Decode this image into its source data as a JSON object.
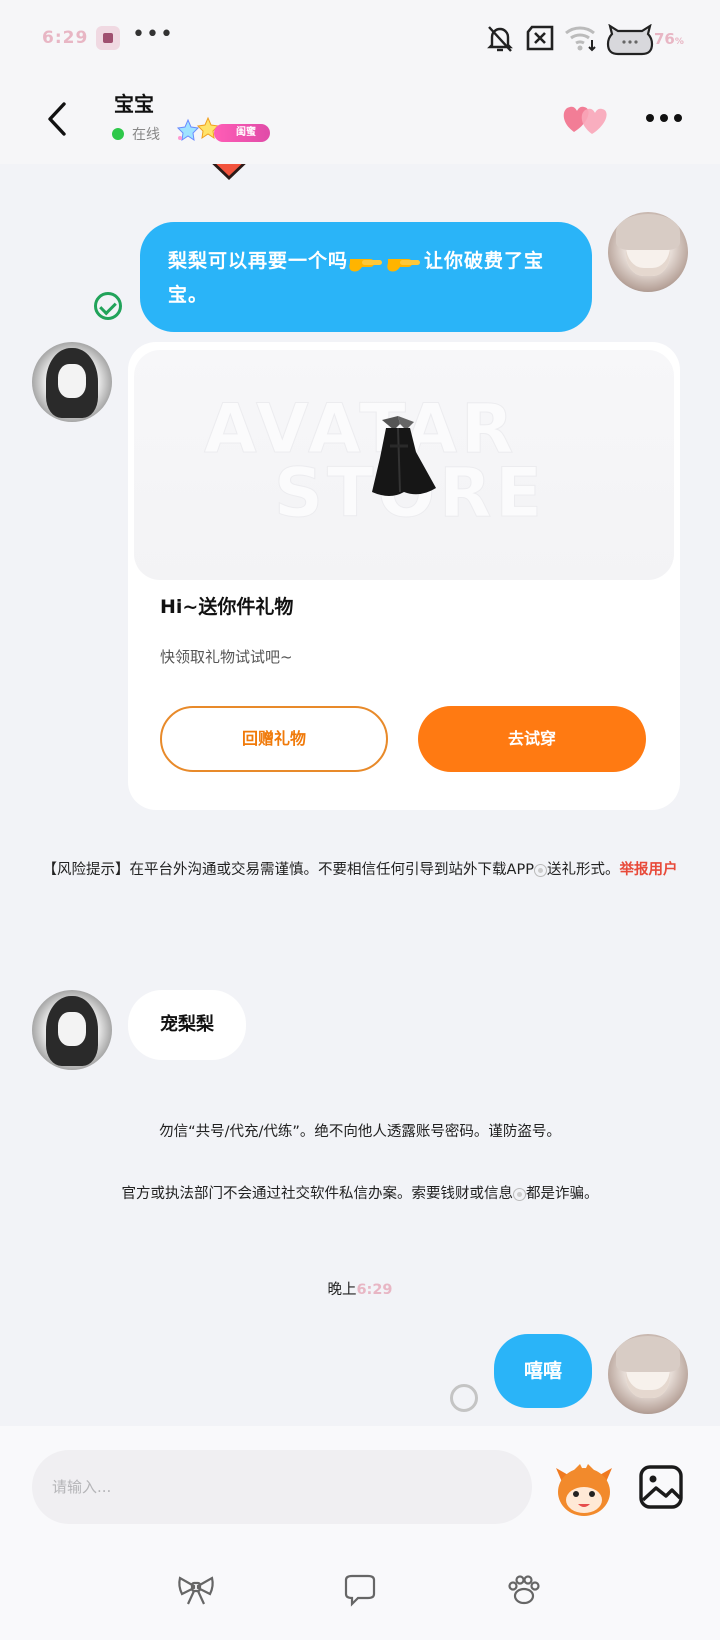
{
  "status_bar": {
    "time": "6:29",
    "dots": "•••",
    "battery": "76"
  },
  "header": {
    "name": "宝宝",
    "status": "在线",
    "badge": "闺蜜"
  },
  "messages": {
    "msg1_text": "梨梨可以再要一个吗👉👉让你破费了宝宝。",
    "msg1_part1": "梨梨可以再要一个吗",
    "msg1_part2": "让你破费了宝宝。",
    "gift_card": {
      "watermark_line1": "AVATAR",
      "watermark_line2": "STORE",
      "title": "Hi~送你件礼物",
      "subtitle": "快领取礼物试试吧~",
      "return_gift_label": "回赠礼物",
      "try_on_label": "去试穿"
    },
    "risk_notice_prefix": "【风险提示】在平台外沟通或交易需谨慎。不要相信任何引导到站外下载APP",
    "risk_notice_suffix": "送礼形式。",
    "report_link": "举报用户",
    "msg2_text": "宠梨梨",
    "system_notice_1": "勿信“共号/代充/代练”。绝不向他人透露账号密码。谨防盗号。",
    "system_notice_2_prefix": "官方或执法部门不会通过社交软件私信办案。索要钱财或信息",
    "system_notice_2_suffix": "都是诈骗。",
    "time_prefix": "晚上",
    "time_value": "6:29",
    "msg3_text": "嘻嘻"
  },
  "input": {
    "placeholder": "请输入..."
  },
  "icons": {
    "back": "chevron-left-icon",
    "hearts": "hearts-icon",
    "more": "more-icon",
    "mascot": "mascot-icon",
    "image": "image-icon",
    "bow": "bow-icon",
    "speech": "speech-bubble-icon",
    "paw": "paw-icon"
  },
  "colors": {
    "bubble_blue": "#2ab4f8",
    "accent_orange": "#ff7a12",
    "online_green": "#2ec84a",
    "report_red": "#e84a3a",
    "badge_pink": "#ff5db6"
  }
}
